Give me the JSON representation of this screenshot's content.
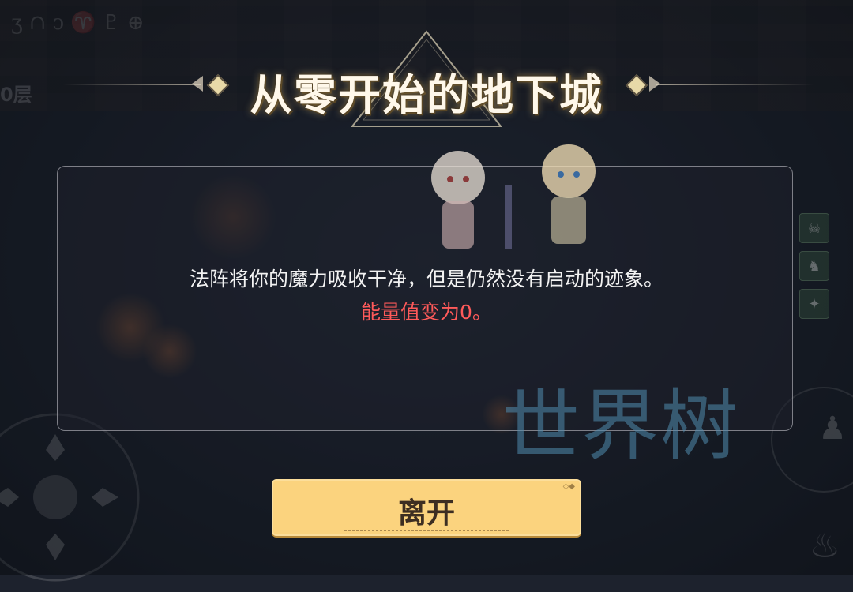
{
  "background": {
    "runes": "ʒ∩ↄ♈♇⊕",
    "floor_label": "0层"
  },
  "header": {
    "title": "从零开始的地下城"
  },
  "dialog": {
    "message": "法阵将你的魔力吸收干净，但是仍然没有启动的迹象。",
    "effect": "能量值变为0。"
  },
  "watermark": "世界树",
  "actions": {
    "leave_label": "离开"
  },
  "colors": {
    "button_bg": "#fbd37e",
    "effect_text": "#ff5a5a",
    "watermark": "#508cae"
  },
  "icons": [
    "joystick-icon",
    "monster-icon",
    "pet-icon",
    "rune-icon",
    "character-silhouette-icon",
    "flame-icon"
  ]
}
